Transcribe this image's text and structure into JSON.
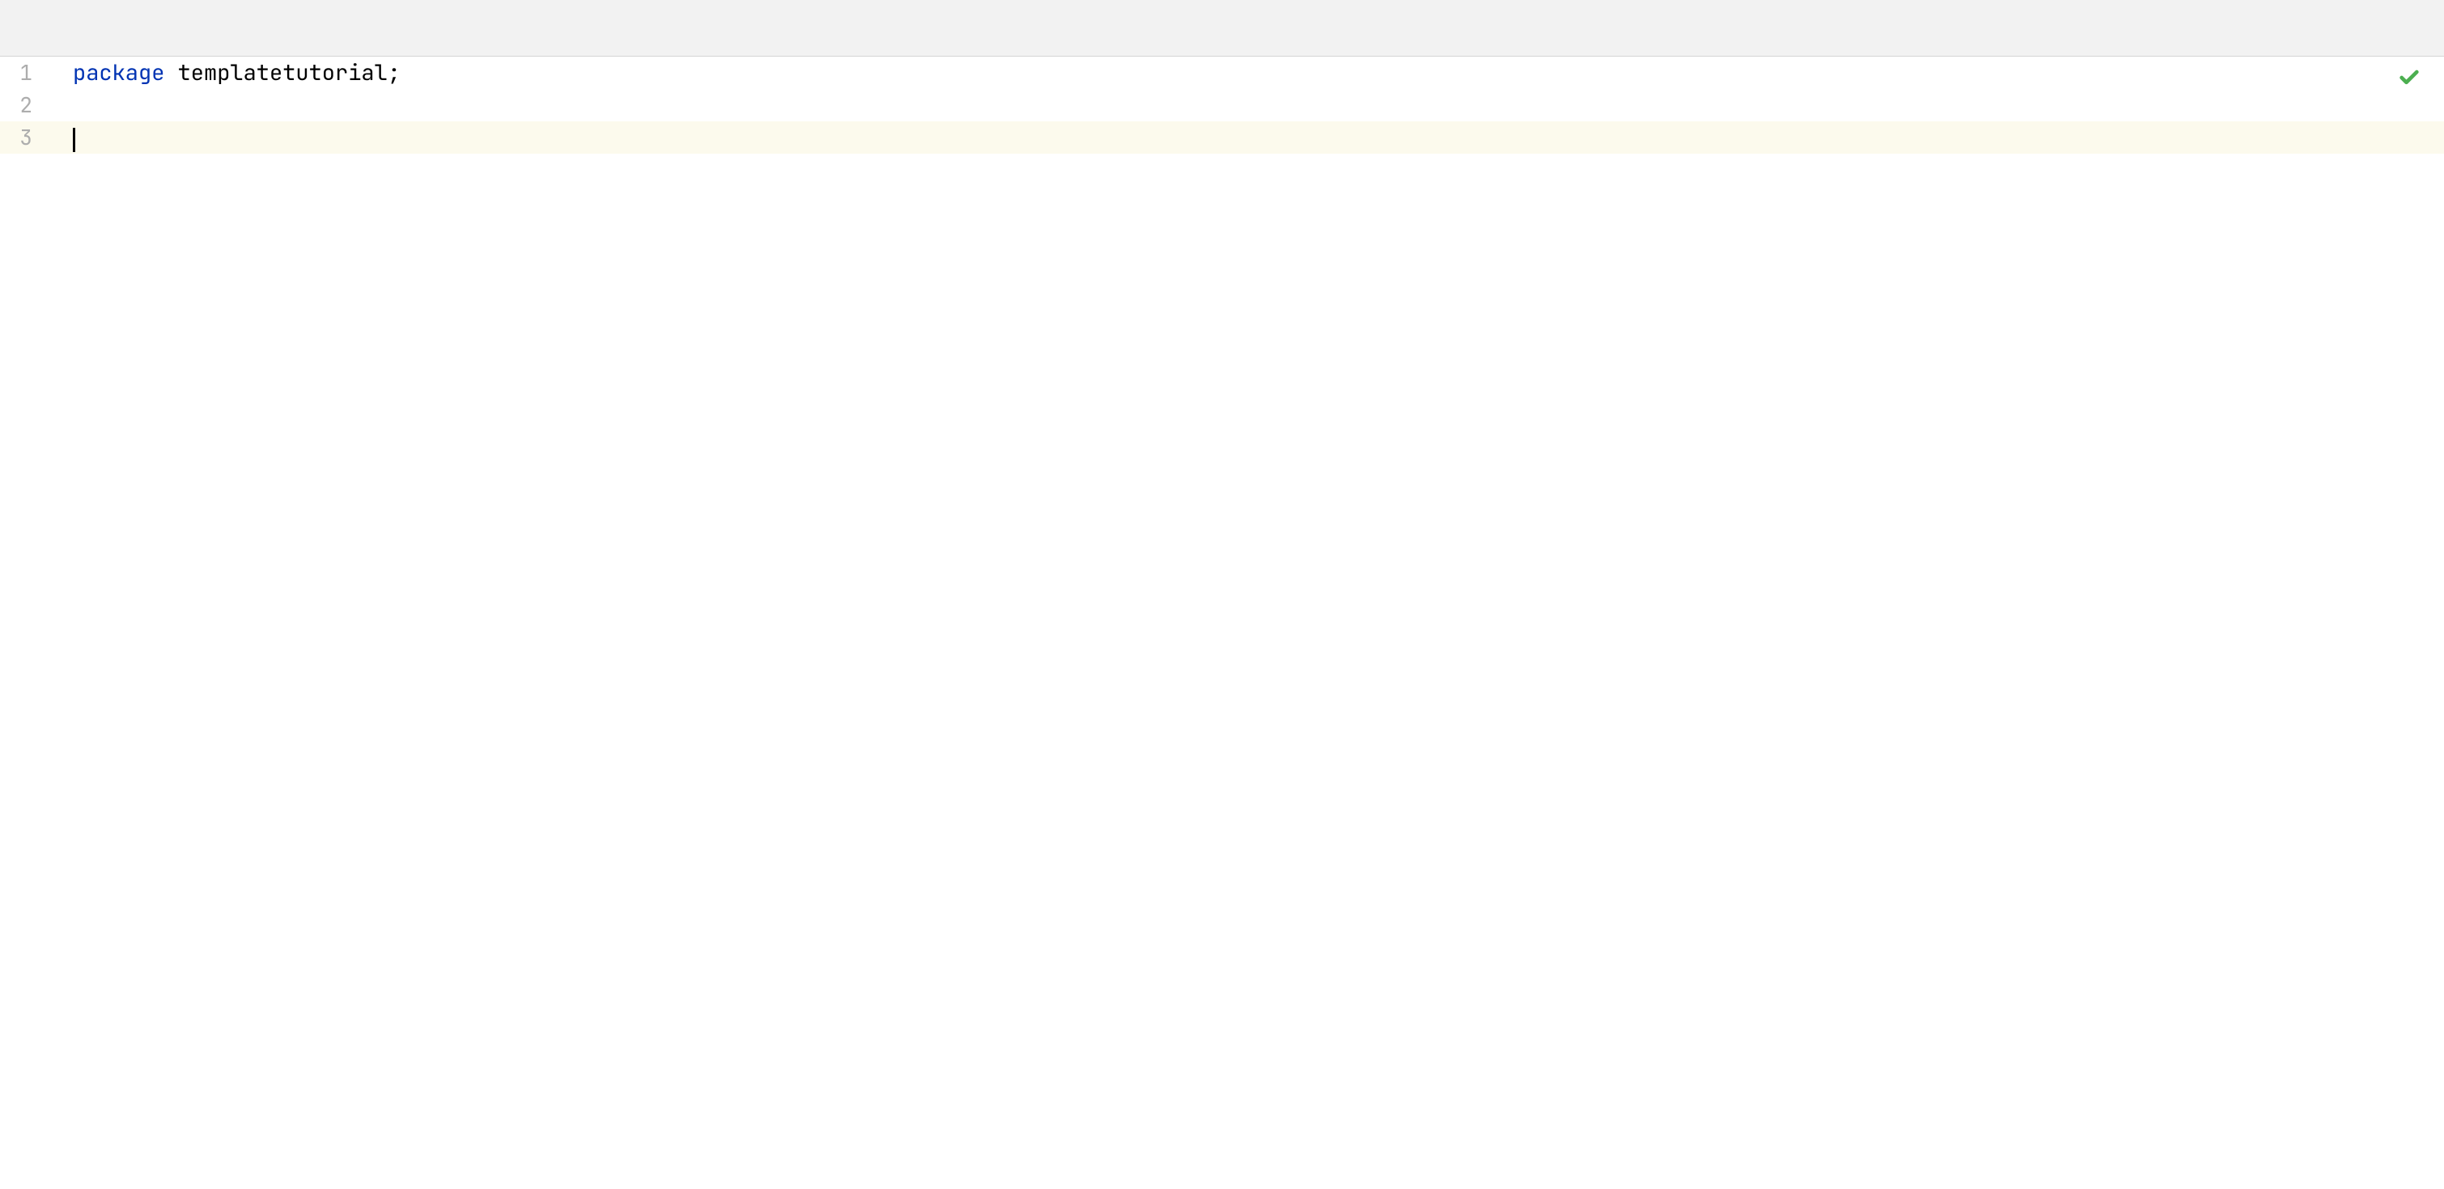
{
  "editor": {
    "lines": [
      {
        "number": "1",
        "tokens": {
          "keyword": "package",
          "space": " ",
          "identifier": "templatetutorial",
          "punctuation": ";"
        },
        "current": false
      },
      {
        "number": "2",
        "tokens": {},
        "current": false
      },
      {
        "number": "3",
        "tokens": {},
        "current": true,
        "cursor": true
      }
    ],
    "status": {
      "icon": "checkmark",
      "color": "#4caf50"
    }
  }
}
